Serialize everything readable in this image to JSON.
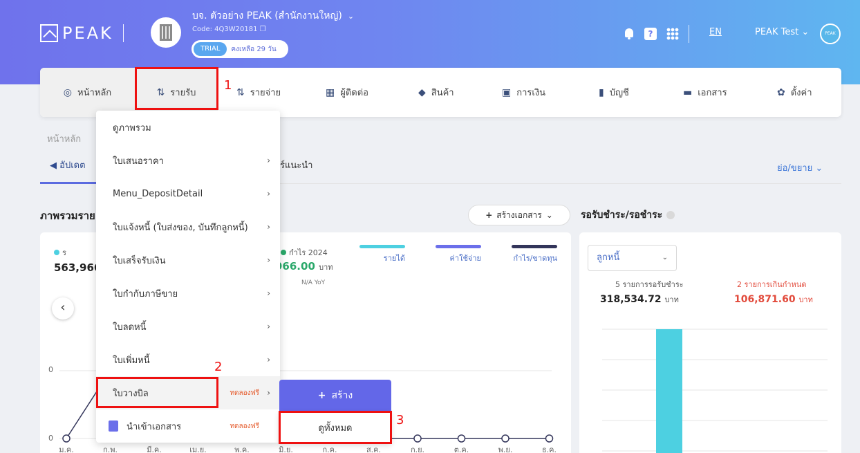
{
  "header": {
    "logo_text": "PEAK",
    "company_name": "บจ. ตัวอย่าง PEAK (สำนักงานใหญ่)",
    "company_code": "Code: 4Q3W20181",
    "trial_label": "TRIAL",
    "trial_remaining": "คงเหลือ 29 วัน",
    "help_label": "?",
    "lang": "EN",
    "user_name": "PEAK Test",
    "avatar_text": "PEAK"
  },
  "nav": {
    "items": [
      {
        "label": "หน้าหลัก",
        "icon": "dashboard-icon"
      },
      {
        "label": "รายรับ",
        "icon": "income-icon"
      },
      {
        "label": "รายจ่าย",
        "icon": "expense-icon"
      },
      {
        "label": "ผู้ติดต่อ",
        "icon": "contacts-icon"
      },
      {
        "label": "สินค้า",
        "icon": "product-icon"
      },
      {
        "label": "การเงิน",
        "icon": "money-icon"
      },
      {
        "label": "บัญชี",
        "icon": "ledger-icon"
      },
      {
        "label": "เอกสาร",
        "icon": "folder-icon"
      },
      {
        "label": "ตั้งค่า",
        "icon": "gear-icon"
      }
    ]
  },
  "annotations": {
    "n1": "1",
    "n2": "2",
    "n3": "3"
  },
  "breadcrumb": "หน้าหลัก",
  "tabs": {
    "updates": "อัปเดต",
    "tips": "ร์แนะนำ",
    "collapse": "ย่อ/ขยาย"
  },
  "overview": {
    "title": "ภาพรวมราย",
    "create_doc": "สร้างเอกสาร",
    "revenue_legend": "ร",
    "revenue_value": "563,966",
    "profit_legend": "กำไร 2024",
    "profit_value": "966.00",
    "profit_unit": "บาท",
    "yoy": "N/A YoY",
    "legend": [
      {
        "label": "รายได้",
        "color": "#4dd0e1"
      },
      {
        "label": "ค่าใช้จ่าย",
        "color": "#6b6fea"
      },
      {
        "label": "กำไร/ขาดทุน",
        "color": "#33355a"
      }
    ],
    "axis_zero": "0"
  },
  "chart_data": {
    "type": "line",
    "categories": [
      "ม.ค.",
      "ก.พ.",
      "มี.ค.",
      "เม.ย.",
      "พ.ค.",
      "มิ.ย.",
      "ก.ค.",
      "ส.ค.",
      "ก.ย.",
      "ต.ค.",
      "พ.ย.",
      "ธ.ค."
    ],
    "series": [
      {
        "name": "กำไร/ขาดทุน",
        "values": [
          0,
          563966,
          null,
          null,
          null,
          null,
          0,
          0,
          0,
          0,
          0,
          0
        ]
      }
    ],
    "ylim": [
      0,
      563966
    ]
  },
  "receivables": {
    "title": "รอรับชำระ/รอชำระ",
    "select_value": "ลูกหนี้",
    "pending_label": "5 รายการรอรับชำระ",
    "pending_value": "318,534.72",
    "overdue_label": "2 รายการเกินกำหนด",
    "overdue_value": "106,871.60",
    "unit": "บาท"
  },
  "dropdown": {
    "items": [
      {
        "label": "ดูภาพรวม",
        "chevron": ""
      },
      {
        "label": "ใบเสนอราคา",
        "chevron": "›"
      },
      {
        "label": "Menu_DepositDetail",
        "chevron": "›"
      },
      {
        "label": "ใบแจ้งหนี้ (ใบส่งของ, บันทึกลูกหนี้)",
        "chevron": "›"
      },
      {
        "label": "ใบเสร็จรับเงิน",
        "chevron": "›"
      },
      {
        "label": "ใบกำกับภาษีขาย",
        "chevron": "›"
      },
      {
        "label": "ใบลดหนี้",
        "chevron": "›"
      },
      {
        "label": "ใบเพิ่มหนี้",
        "chevron": "›"
      },
      {
        "label": "ใบวางบิล",
        "chevron": "›",
        "badge": "ทดลองฟรี"
      },
      {
        "label": "นำเข้าเอกสาร",
        "chevron": "",
        "badge": "ทดลองฟรี"
      }
    ]
  },
  "submenu": {
    "create": "สร้าง",
    "view_all": "ดูทั้งหมด"
  }
}
